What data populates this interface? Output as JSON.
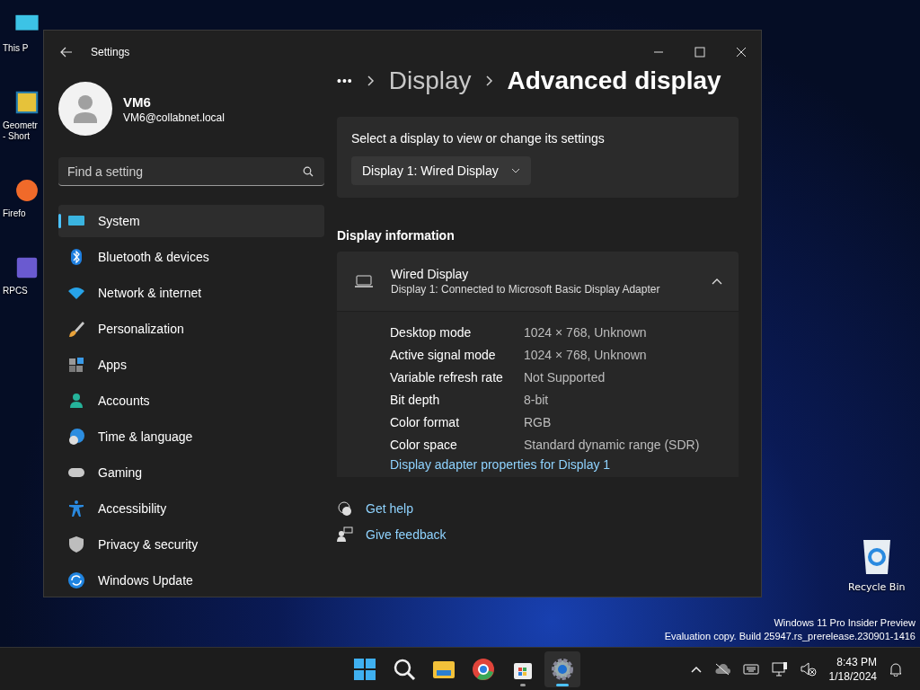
{
  "desktop": {
    "icons": [
      {
        "label": "This P"
      },
      {
        "label": "Geometr\n- Short"
      },
      {
        "label": "Firefo"
      },
      {
        "label": "RPCS"
      }
    ],
    "recycle_bin": {
      "label": "Recycle Bin"
    },
    "watermark_lines": [
      "Windows 11 Pro Insider Preview",
      "Evaluation copy. Build 25947.rs_prerelease.230901-1416"
    ]
  },
  "window": {
    "title": "Settings"
  },
  "account": {
    "name": "VM6",
    "email": "VM6@collabnet.local"
  },
  "search": {
    "placeholder": "Find a setting"
  },
  "sidebar": {
    "items": [
      {
        "label": "System",
        "selected": true
      },
      {
        "label": "Bluetooth & devices",
        "selected": false
      },
      {
        "label": "Network & internet",
        "selected": false
      },
      {
        "label": "Personalization",
        "selected": false
      },
      {
        "label": "Apps",
        "selected": false
      },
      {
        "label": "Accounts",
        "selected": false
      },
      {
        "label": "Time & language",
        "selected": false
      },
      {
        "label": "Gaming",
        "selected": false
      },
      {
        "label": "Accessibility",
        "selected": false
      },
      {
        "label": "Privacy & security",
        "selected": false
      },
      {
        "label": "Windows Update",
        "selected": false
      }
    ]
  },
  "breadcrumb": {
    "ellipsis": "•••",
    "items": [
      "Display",
      "Advanced display"
    ]
  },
  "select_display": {
    "label": "Select a display to view or change its settings",
    "value": "Display 1: Wired Display"
  },
  "display_info": {
    "heading": "Display information",
    "title": "Wired Display",
    "subtitle": "Display 1: Connected to Microsoft Basic Display Adapter",
    "expanded": true,
    "rows": [
      {
        "label": "Desktop mode",
        "value": "1024 × 768, Unknown"
      },
      {
        "label": "Active signal mode",
        "value": "1024 × 768, Unknown"
      },
      {
        "label": "Variable refresh rate",
        "value": "Not Supported"
      },
      {
        "label": "Bit depth",
        "value": "8-bit"
      },
      {
        "label": "Color format",
        "value": "RGB"
      },
      {
        "label": "Color space",
        "value": "Standard dynamic range (SDR)"
      }
    ],
    "link": "Display adapter properties for Display 1"
  },
  "help_links": [
    "Get help",
    "Give feedback"
  ],
  "taskbar": {
    "apps": [
      {
        "running": false,
        "selected": false
      },
      {
        "running": false,
        "selected": false
      },
      {
        "running": false,
        "selected": false
      },
      {
        "running": false,
        "selected": false
      },
      {
        "running": true,
        "selected": false
      },
      {
        "running": true,
        "selected": true
      }
    ],
    "time": "8:43 PM",
    "date": "1/18/2024"
  }
}
